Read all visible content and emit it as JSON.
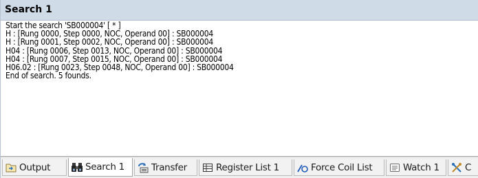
{
  "window": {
    "title": "Search 1"
  },
  "output": {
    "lines": [
      "Start the search 'SB000004' [ * ]",
      "H : [Rung 0000, Step 0000, NOC, Operand 00] : SB000004",
      "H : [Rung 0001, Step 0002, NOC, Operand 00] : SB000004",
      "H04 : [Rung 0006, Step 0013, NOC, Operand 00] : SB000004",
      "H04 : [Rung 0007, Step 0015, NOC, Operand 00] : SB000004",
      "H06.02 : [Rung 0023, Step 0048, NOC, Operand 00] : SB000004",
      "End of search. 5 founds."
    ]
  },
  "tabs": [
    {
      "label": "Output",
      "icon": "output-icon",
      "active": false
    },
    {
      "label": "Search 1",
      "icon": "binoculars-icon",
      "active": true
    },
    {
      "label": "Transfer",
      "icon": "transfer-icon",
      "active": false
    },
    {
      "label": "Register List 1",
      "icon": "register-list-icon",
      "active": false
    },
    {
      "label": "Force Coil List",
      "icon": "force-coil-icon",
      "active": false
    },
    {
      "label": "Watch 1",
      "icon": "watch-icon",
      "active": false
    },
    {
      "label": "C",
      "icon": "tools-icon",
      "active": false
    }
  ]
}
